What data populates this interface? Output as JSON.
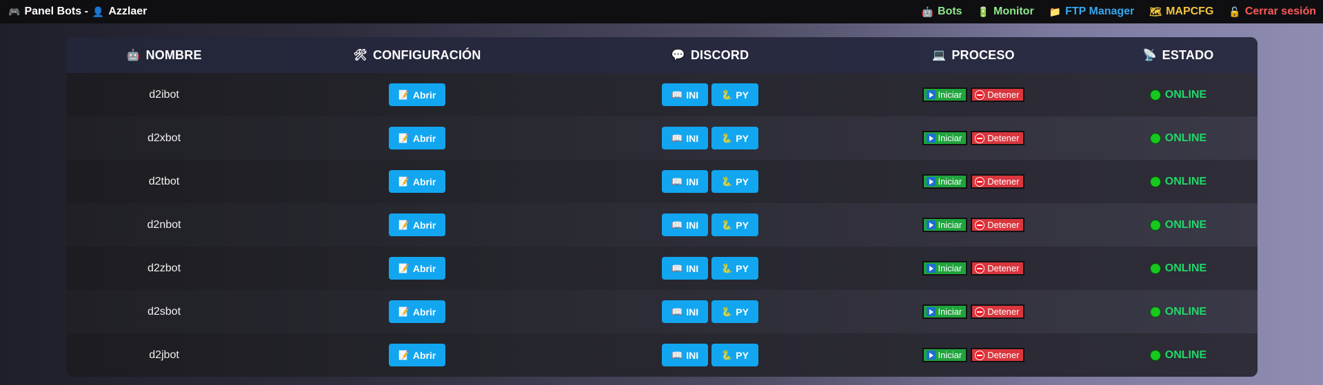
{
  "header": {
    "title": "Panel Bots -",
    "user": "Azzlaer",
    "nav": [
      {
        "icon": "🤖",
        "label": "Bots",
        "color": "#8ee88a"
      },
      {
        "icon": "🔋",
        "label": "Monitor",
        "color": "#8ee88a"
      },
      {
        "icon": "📁",
        "label": "FTP Manager",
        "color": "#35a8f0"
      },
      {
        "icon": "🗺",
        "label": "MAPCFG",
        "color": "#f2c53d"
      },
      {
        "icon": "🔓",
        "label": "Cerrar sesión",
        "color": "#ff5a5a"
      }
    ]
  },
  "table": {
    "columns": [
      {
        "icon": "🤖",
        "label": "NOMBRE"
      },
      {
        "icon": "🛠",
        "label": "CONFIGURACIÓN"
      },
      {
        "icon": "💬",
        "label": "DISCORD"
      },
      {
        "icon": "💻",
        "label": "PROCESO"
      },
      {
        "icon": "📡",
        "label": "ESTADO"
      }
    ],
    "buttons": {
      "config": "Abrir",
      "ini": "INI",
      "py": "PY",
      "start": "Iniciar",
      "stop": "Detener"
    },
    "status_color": "#20d86a",
    "rows": [
      {
        "name": "d2ibot",
        "status": "ONLINE"
      },
      {
        "name": "d2xbot",
        "status": "ONLINE"
      },
      {
        "name": "d2tbot",
        "status": "ONLINE"
      },
      {
        "name": "d2nbot",
        "status": "ONLINE"
      },
      {
        "name": "d2zbot",
        "status": "ONLINE"
      },
      {
        "name": "d2sbot",
        "status": "ONLINE"
      },
      {
        "name": "d2jbot",
        "status": "ONLINE"
      }
    ]
  }
}
